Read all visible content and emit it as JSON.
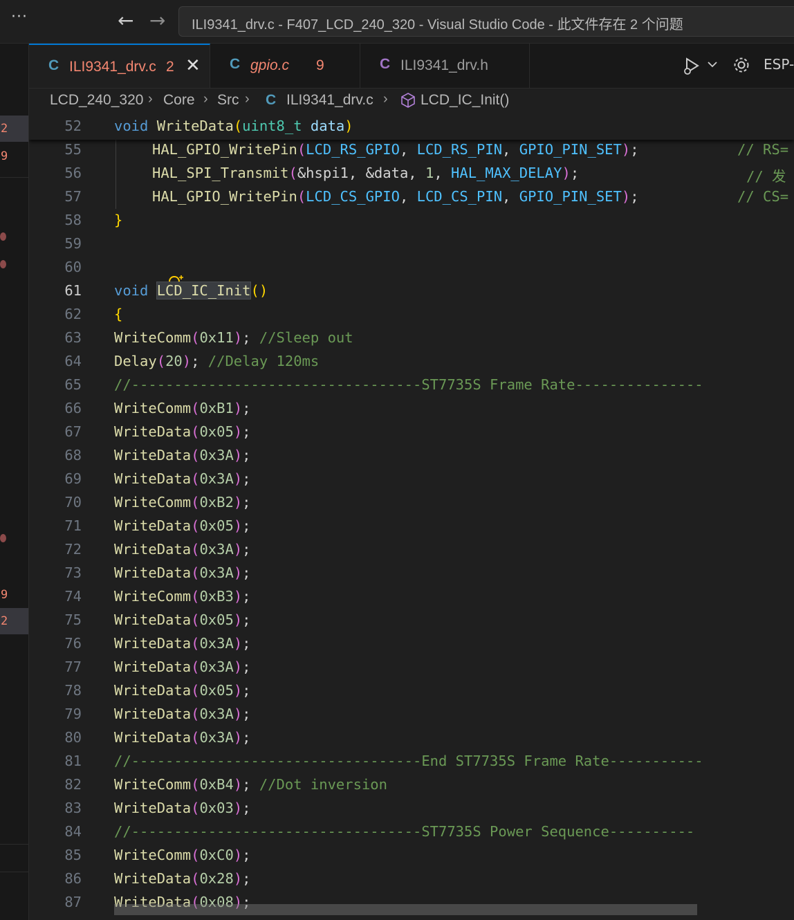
{
  "titlebar": {
    "more": "···",
    "back": "←",
    "forward": "→",
    "search_text": "ILI9341_drv.c - F407_LCD_240_320 - Visual Studio Code - 此文件存在 2 个问题"
  },
  "activity_markers": [
    "2",
    "9",
    "9",
    "2"
  ],
  "tabs": [
    {
      "icon": "C",
      "label": "ILI9341_drv.c",
      "count": "2",
      "close": "✕"
    },
    {
      "icon": "C",
      "label": "gpio.c",
      "count": "9"
    },
    {
      "icon": "C",
      "label": "ILI9341_drv.h"
    }
  ],
  "toolbar": {
    "more_actions": "ESP-I"
  },
  "breadcrumb": {
    "items": [
      "LCD_240_320",
      "Core",
      "Src",
      "ILI9341_drv.c",
      "LCD_IC_Init()"
    ],
    "file_icon": "C",
    "sep": "›"
  },
  "line_numbers": [
    "52",
    "55",
    "56",
    "57",
    "58",
    "59",
    "60",
    "61",
    "62",
    "63",
    "64",
    "65",
    "66",
    "67",
    "68",
    "69",
    "70",
    "71",
    "72",
    "73",
    "74",
    "75",
    "76",
    "77",
    "78",
    "79",
    "80",
    "81",
    "82",
    "83",
    "84",
    "85",
    "86",
    "87"
  ],
  "code": {
    "l52": {
      "kw": "void",
      "fn": "WriteData",
      "open": "(",
      "ty": "uint8_t",
      "var": "data",
      "close": ")"
    },
    "l55": {
      "fn": "HAL_GPIO_WritePin",
      "open": "(",
      "a1": "LCD_RS_GPIO",
      "c1": ", ",
      "a2": "LCD_RS_PIN",
      "c2": ", ",
      "a3": "GPIO_PIN_SET",
      "close": ")",
      "semi": ";",
      "cm": "// RS="
    },
    "l56": {
      "fn": "HAL_SPI_Transmit",
      "open": "(",
      "a1": "&hspi1",
      "c1": ", ",
      "a2": "&data",
      "c2": ", ",
      "a3": "1",
      "c3": ", ",
      "a4": "HAL_MAX_DELAY",
      "close": ")",
      "semi": ";",
      "cm": "// 发"
    },
    "l57": {
      "fn": "HAL_GPIO_WritePin",
      "open": "(",
      "a1": "LCD_CS_GPIO",
      "c1": ", ",
      "a2": "LCD_CS_PIN",
      "c2": ", ",
      "a3": "GPIO_PIN_SET",
      "close": ")",
      "semi": ";",
      "cm": "// CS="
    },
    "l58": "}",
    "l61": {
      "kw": "void",
      "fn": "LCD_IC_Init",
      "parens": "()"
    },
    "l62": "{",
    "l63": {
      "fn": "WriteComm",
      "open": "(",
      "num": "0x11",
      "close": ")",
      "semi": ";",
      "cm": "//Sleep out"
    },
    "l64": {
      "fn": "Delay",
      "open": "(",
      "num": "20",
      "close": ")",
      "semi": ";",
      "cm": "//Delay 120ms"
    },
    "l65": "//----------------------------------ST7735S Frame Rate---------------",
    "l66": {
      "fn": "WriteComm",
      "num": "0xB1"
    },
    "l67": {
      "fn": "WriteData",
      "num": "0x05"
    },
    "l68": {
      "fn": "WriteData",
      "num": "0x3A"
    },
    "l69": {
      "fn": "WriteData",
      "num": "0x3A"
    },
    "l70": {
      "fn": "WriteComm",
      "num": "0xB2"
    },
    "l71": {
      "fn": "WriteData",
      "num": "0x05"
    },
    "l72": {
      "fn": "WriteData",
      "num": "0x3A"
    },
    "l73": {
      "fn": "WriteData",
      "num": "0x3A"
    },
    "l74": {
      "fn": "WriteComm",
      "num": "0xB3"
    },
    "l75": {
      "fn": "WriteData",
      "num": "0x05"
    },
    "l76": {
      "fn": "WriteData",
      "num": "0x3A"
    },
    "l77": {
      "fn": "WriteData",
      "num": "0x3A"
    },
    "l78": {
      "fn": "WriteData",
      "num": "0x05"
    },
    "l79": {
      "fn": "WriteData",
      "num": "0x3A"
    },
    "l80": {
      "fn": "WriteData",
      "num": "0x3A"
    },
    "l81": "//----------------------------------End ST7735S Frame Rate-----------",
    "l82": {
      "fn": "WriteComm",
      "open": "(",
      "num": "0xB4",
      "close": ")",
      "semi": ";",
      "cm": "//Dot inversion"
    },
    "l83": {
      "fn": "WriteData",
      "num": "0x03"
    },
    "l84": "//----------------------------------ST7735S Power Sequence----------",
    "l85": {
      "fn": "WriteComm",
      "num": "0xC0"
    },
    "l86": {
      "fn": "WriteData",
      "num": "0x28"
    },
    "l87": {
      "fn": "WriteData",
      "num": "0x08"
    }
  },
  "colors": {
    "accent": "#0078d4",
    "error": "#f48771",
    "keyword": "#569cd6",
    "function": "#dcdcaa",
    "number": "#b5cea8",
    "comment": "#6a9955"
  }
}
